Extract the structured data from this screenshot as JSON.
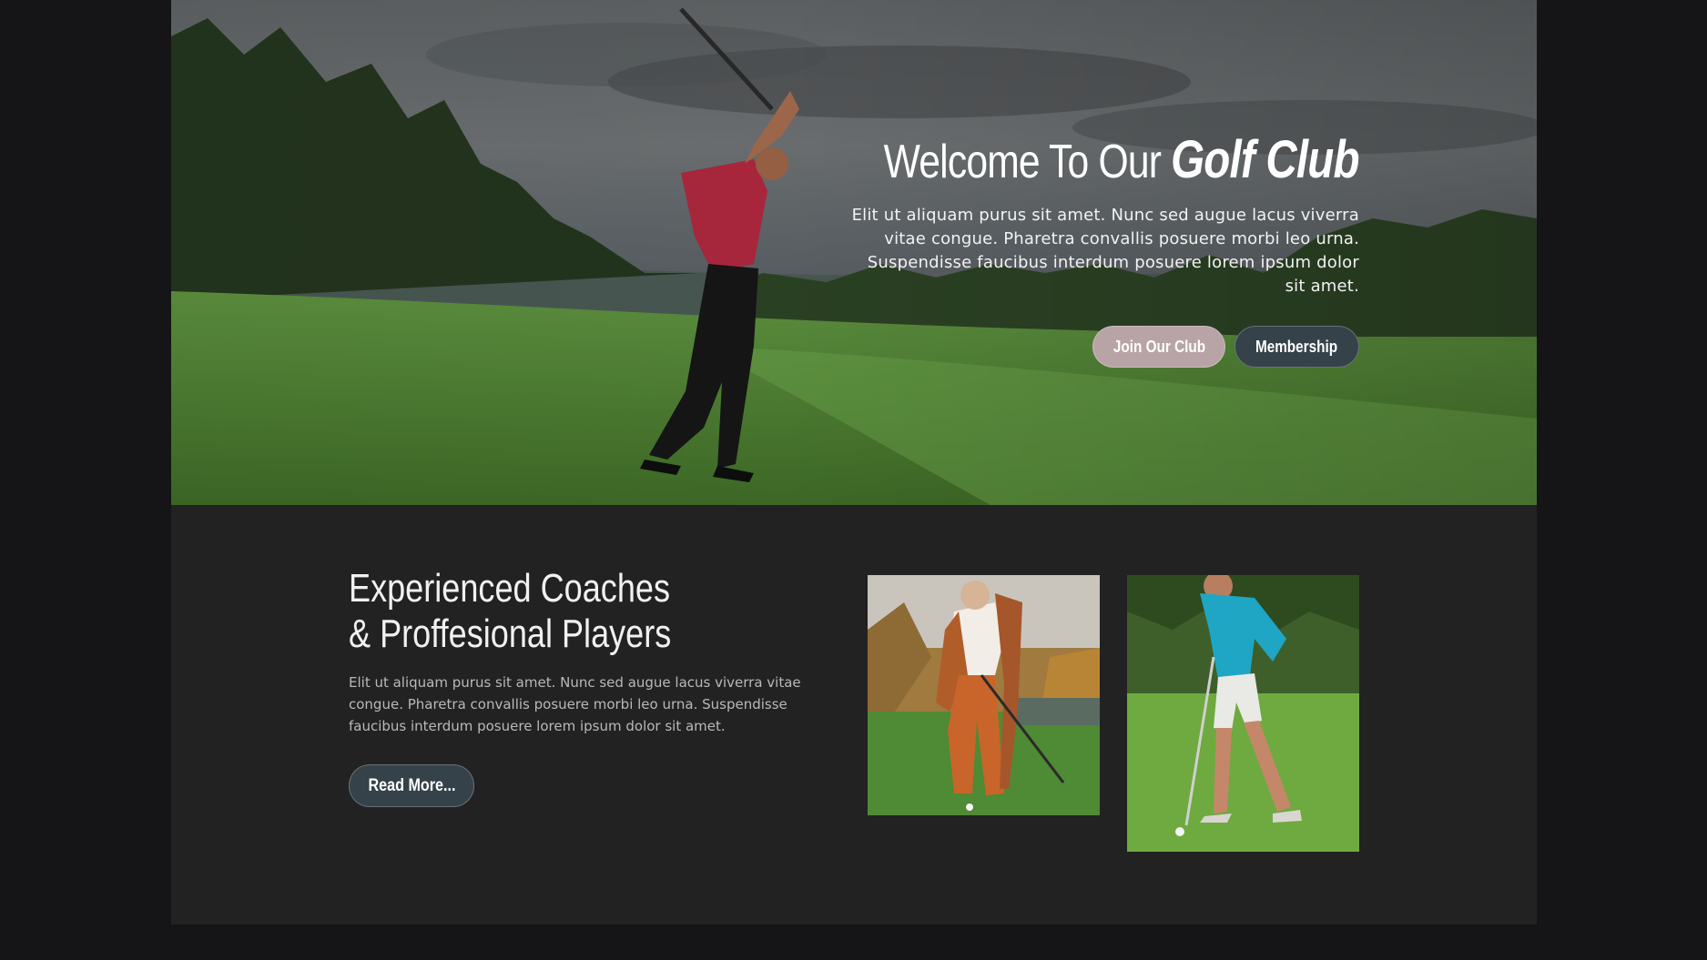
{
  "hero": {
    "title_plain": "Welcome To Our ",
    "title_emphasis": "Golf Club",
    "text": "Elit ut aliquam purus sit amet. Nunc sed augue lacus viverra vitae congue. Pharetra convallis posuere morbi leo urna. Suspendisse faucibus interdum posuere lorem ipsum dolor sit amet.",
    "join_label": "Join Our Club",
    "membership_label": "Membership"
  },
  "coaches": {
    "title_line1": "Experienced Coaches",
    "title_line2": "& Proffesional Players",
    "text": "Elit ut aliquam purus sit amet. Nunc sed augue lacus viverra vitae congue. Pharetra convallis posuere morbi leo urna. Suspendisse faucibus interdum posuere lorem ipsum dolor sit amet.",
    "read_more_label": "Read More..."
  },
  "colors": {
    "page_bg": "#151517",
    "section_bg": "#222223",
    "join_button": "#b8a4a6",
    "dark_button": "#35424a"
  }
}
